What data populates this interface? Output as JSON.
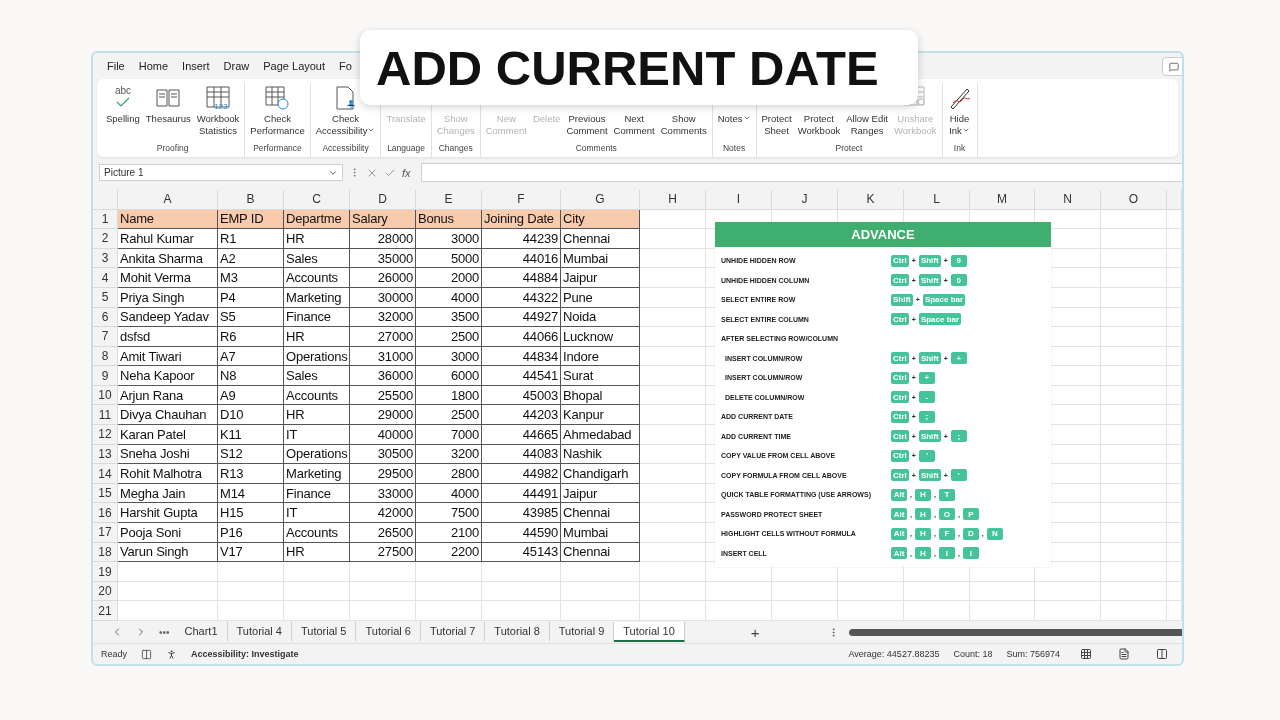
{
  "title_overlay": {
    "text": "ADD CURRENT DATE"
  },
  "menu_tabs": [
    "File",
    "Home",
    "Insert",
    "Draw",
    "Page Layout",
    "Fo"
  ],
  "ribbon": {
    "groups": [
      {
        "name": "Proofing",
        "buttons": [
          {
            "label": "Spelling",
            "kind": "spelling",
            "icon_text": "abc",
            "disabled": false
          },
          {
            "label": "Thesaurus",
            "kind": "book",
            "disabled": false
          },
          {
            "label": "Workbook\nStatistics",
            "kind": "stats",
            "icon_text": "123",
            "disabled": false
          }
        ]
      },
      {
        "name": "Performance",
        "buttons": [
          {
            "label": "Check\nPerformance",
            "kind": "perf",
            "disabled": false
          }
        ]
      },
      {
        "name": "Accessibility",
        "buttons": [
          {
            "label": "Check\nAccessibility",
            "kind": "access",
            "dropdown": true,
            "disabled": false
          }
        ]
      },
      {
        "name": "Language",
        "buttons": [
          {
            "label": "Translate",
            "kind": "plain",
            "disabled": true
          }
        ]
      },
      {
        "name": "Changes",
        "buttons": [
          {
            "label": "Show\nChanges",
            "kind": "plain",
            "disabled": true
          }
        ]
      },
      {
        "name": "Comments",
        "buttons": [
          {
            "label": "New\nComment",
            "kind": "plain",
            "disabled": true
          },
          {
            "label": "Delete",
            "kind": "plain",
            "disabled": true
          },
          {
            "label": "Previous\nComment",
            "kind": "plain",
            "disabled": false
          },
          {
            "label": "Next\nComment",
            "kind": "plain",
            "disabled": false
          },
          {
            "label": "Show\nComments",
            "kind": "plain",
            "disabled": false
          }
        ]
      },
      {
        "name": "Notes",
        "buttons": [
          {
            "label": "Notes",
            "kind": "plain",
            "dropdown": true,
            "disabled": false
          }
        ]
      },
      {
        "name": "Protect",
        "buttons": [
          {
            "label": "Protect\nSheet",
            "kind": "plain",
            "disabled": false
          },
          {
            "label": "Protect\nWorkbook",
            "kind": "plain",
            "disabled": false
          },
          {
            "label": "Allow Edit\nRanges",
            "kind": "plain",
            "disabled": false
          },
          {
            "label": "Unshare\nWorkbook",
            "kind": "unshare",
            "disabled": true
          }
        ]
      },
      {
        "name": "Ink",
        "buttons": [
          {
            "label": "Hide\nInk",
            "kind": "ink",
            "dropdown": true,
            "disabled": false
          }
        ]
      }
    ]
  },
  "formula_bar": {
    "name_box": "Picture 1",
    "fx": "fx"
  },
  "sheet": {
    "column_letters": [
      "A",
      "B",
      "C",
      "D",
      "E",
      "F",
      "G",
      "H",
      "I",
      "J",
      "K",
      "L",
      "M",
      "N",
      "O"
    ],
    "row_numbers": [
      "1",
      "2",
      "3",
      "4",
      "5",
      "6",
      "7",
      "8",
      "9",
      "10",
      "11",
      "12",
      "13",
      "14",
      "15",
      "16",
      "17",
      "18",
      "19",
      "20",
      "21"
    ],
    "columns": [
      "Name",
      "EMP ID",
      "Departme",
      "Salary",
      "Bonus",
      "Joining Date",
      "City"
    ],
    "rows": [
      [
        "Rahul Kumar",
        "R1",
        "HR",
        "28000",
        "3000",
        "44239",
        "Chennai"
      ],
      [
        "Ankita Sharma",
        "A2",
        "Sales",
        "35000",
        "5000",
        "44016",
        "Mumbai"
      ],
      [
        "Mohit Verma",
        "M3",
        "Accounts",
        "26000",
        "2000",
        "44884",
        "Jaipur"
      ],
      [
        "Priya Singh",
        "P4",
        "Marketing",
        "30000",
        "4000",
        "44322",
        "Pune"
      ],
      [
        "Sandeep Yadav",
        "S5",
        "Finance",
        "32000",
        "3500",
        "44927",
        "Noida"
      ],
      [
        "dsfsd",
        "R6",
        "HR",
        "27000",
        "2500",
        "44066",
        "Lucknow"
      ],
      [
        "Amit Tiwari",
        "A7",
        "Operations",
        "31000",
        "3000",
        "44834",
        "Indore"
      ],
      [
        "Neha Kapoor",
        "N8",
        "Sales",
        "36000",
        "6000",
        "44541",
        "Surat"
      ],
      [
        "Arjun Rana",
        "A9",
        "Accounts",
        "25500",
        "1800",
        "45003",
        "Bhopal"
      ],
      [
        "Divya Chauhan",
        "D10",
        "HR",
        "29000",
        "2500",
        "44203",
        "Kanpur"
      ],
      [
        "Karan Patel",
        "K11",
        "IT",
        "40000",
        "7000",
        "44665",
        "Ahmedabad"
      ],
      [
        "Sneha Joshi",
        "S12",
        "Operations",
        "30500",
        "3200",
        "44083",
        "Nashik"
      ],
      [
        "Rohit Malhotra",
        "R13",
        "Marketing",
        "29500",
        "2800",
        "44982",
        "Chandigarh"
      ],
      [
        "Megha Jain",
        "M14",
        "Finance",
        "33000",
        "4000",
        "44491",
        "Jaipur"
      ],
      [
        "Harshit Gupta",
        "H15",
        "IT",
        "42000",
        "7500",
        "43985",
        "Chennai"
      ],
      [
        "Pooja Soni",
        "P16",
        "Accounts",
        "26500",
        "2100",
        "44590",
        "Mumbai"
      ],
      [
        "Varun Singh",
        "V17",
        "HR",
        "27500",
        "2200",
        "45143",
        "Chennai"
      ]
    ]
  },
  "advance_panel": {
    "title": "ADVANCE",
    "items": [
      {
        "label": "UNHIDE HIDDEN ROW",
        "keys": [
          "Ctrl",
          "+",
          "Shift",
          "+",
          "9"
        ]
      },
      {
        "label": "UNHIDE HIDDEN COLUMN",
        "keys": [
          "Ctrl",
          "+",
          "Shift",
          "+",
          "0"
        ]
      },
      {
        "label": "SELECT ENTIRE ROW",
        "keys": [
          "Shift",
          "+",
          "Space bar"
        ]
      },
      {
        "label": "SELECT ENTIRE COLUMN",
        "keys": [
          "Ctrl",
          "+",
          "Space bar"
        ]
      },
      {
        "label": "AFTER SELECTING ROW/COLUMN",
        "children": [
          {
            "label": "INSERT COLUMN/ROW",
            "keys": [
              "Ctrl",
              "+",
              "Shift",
              "+",
              "+"
            ]
          },
          {
            "label": "INSERT COLUMN/ROW",
            "keys": [
              "Ctrl",
              "+",
              "+"
            ]
          },
          {
            "label": "DELETE COLUMN/ROW",
            "keys": [
              "Ctrl",
              "+",
              "-"
            ]
          }
        ]
      },
      {
        "label": "ADD CURRENT DATE",
        "keys": [
          "Ctrl",
          "+",
          ";"
        ]
      },
      {
        "label": "ADD CURRENT TIME",
        "keys": [
          "Ctrl",
          "+",
          "Shift",
          "+",
          ";"
        ]
      },
      {
        "label": "COPY VALUE FROM CELL ABOVE",
        "keys": [
          "Ctrl",
          "+",
          "'"
        ]
      },
      {
        "label": "COPY FORMULA FROM CELL ABOVE",
        "keys": [
          "Ctrl",
          "+",
          "Shift",
          "+",
          "'"
        ]
      },
      {
        "label": "QUICK TABLE FORMATTING (USE ARROWS)",
        "keys": [
          "Alt",
          ",",
          "H",
          ",",
          "T"
        ]
      },
      {
        "label": "PASSWORD PROTECT SHEET",
        "keys": [
          "Alt",
          ",",
          "H",
          ",",
          "O",
          ",",
          "P"
        ]
      },
      {
        "label": "HIGHLIGHT CELLS WITHOUT FORMULA",
        "keys": [
          "Alt",
          ",",
          "H",
          ",",
          "F",
          ",",
          "D",
          ",",
          "N"
        ]
      },
      {
        "label": "INSERT CELL",
        "keys": [
          "Alt",
          ",",
          "H",
          ",",
          "I",
          ",",
          "I"
        ]
      }
    ]
  },
  "sheet_tabs": {
    "more": "•••",
    "add": "+",
    "tabs": [
      {
        "label": "Chart1",
        "selected": false
      },
      {
        "label": "Tutorial 4",
        "selected": false
      },
      {
        "label": "Tutorial 5",
        "selected": false
      },
      {
        "label": "Tutorial 6",
        "selected": false
      },
      {
        "label": "Tutorial 7",
        "selected": false
      },
      {
        "label": "Tutorial 8",
        "selected": false
      },
      {
        "label": "Tutorial 9",
        "selected": false
      },
      {
        "label": "Tutorial 10",
        "selected": true
      }
    ]
  },
  "status_bar": {
    "ready": "Ready",
    "accessibility": "Accessibility: Investigate",
    "average": "Average: 44527.88235",
    "count": "Count: 18",
    "sum": "Sum: 756974"
  }
}
